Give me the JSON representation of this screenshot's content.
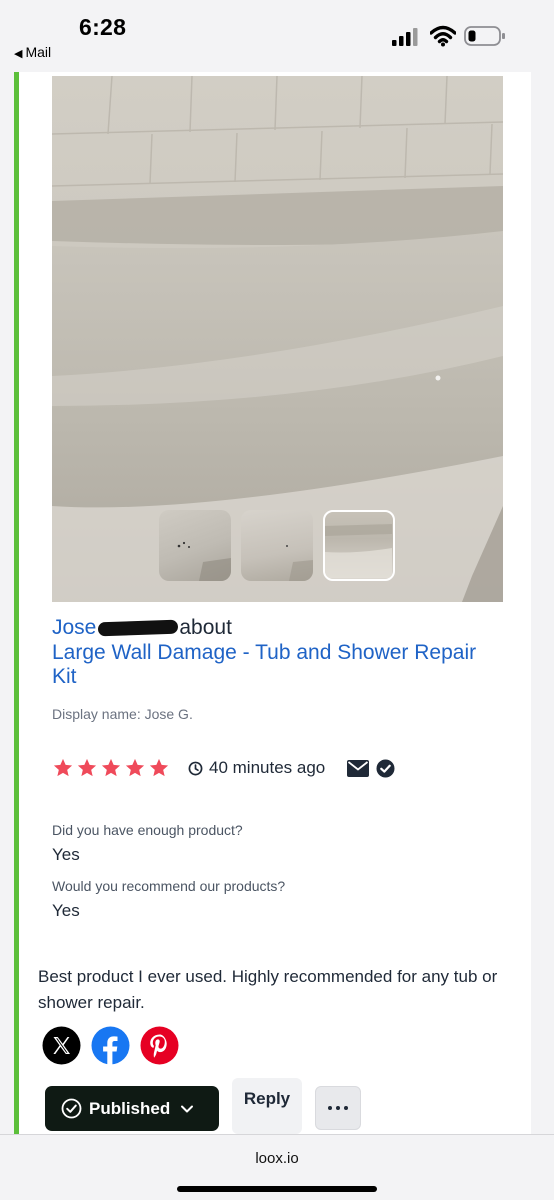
{
  "status_bar": {
    "time": "6:28",
    "back_label": "Mail",
    "back_icon": "back-triangle-icon",
    "indicators": [
      "cellular-signal-icon",
      "wifi-icon",
      "battery-icon"
    ]
  },
  "review": {
    "reviewer_name": "Jose",
    "about_word": "about",
    "product_name": "Large Wall Damage - Tub and Shower Repair Kit",
    "display_name": "Display name: Jose G.",
    "rating": 5,
    "rating_max": 5,
    "time_ago": "40 minutes ago",
    "questions": [
      {
        "question": "Did you have enough product?",
        "answer": "Yes"
      },
      {
        "question": "Would you recommend our products?",
        "answer": "Yes"
      }
    ],
    "body": "Best product I ever used. Highly recommended for any tub or shower repair.",
    "thumbnails_count": 3,
    "selected_thumbnail": 3
  },
  "share": {
    "icons": [
      "x-icon",
      "facebook-icon",
      "pinterest-icon"
    ]
  },
  "actions": {
    "published_label": "Published",
    "reply_label": "Reply"
  },
  "browser": {
    "url": "loox.io"
  },
  "colors": {
    "accent_bar": "#5cbf3a",
    "link_blue": "#1f63c6",
    "star_red": "#ef4a5a",
    "published_bg": "#0f1a14",
    "facebook_blue": "#1877f2",
    "pinterest_red": "#e60023"
  }
}
